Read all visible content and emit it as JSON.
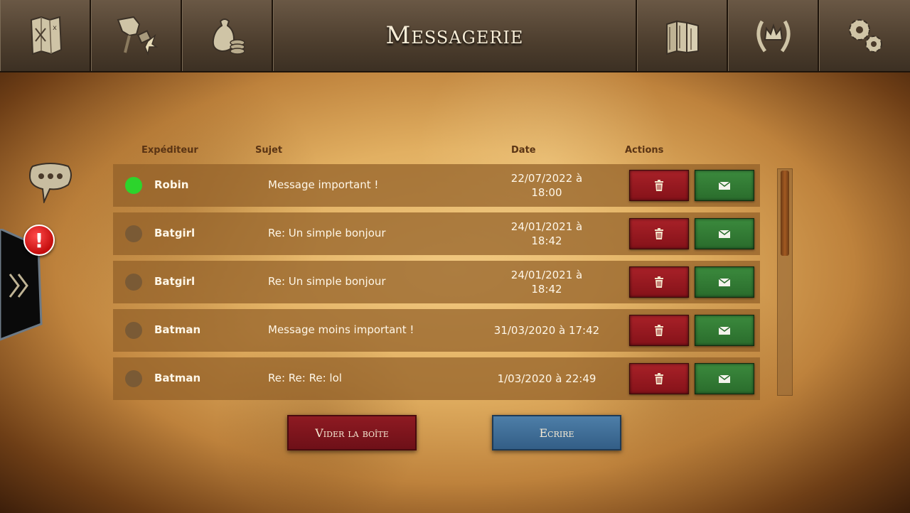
{
  "header": {
    "title": "Messagerie",
    "icons_left": [
      "map-icon",
      "hammer-icon",
      "treasure-bag-icon"
    ],
    "icons_right": [
      "books-icon",
      "crown-laurel-icon",
      "gears-icon"
    ]
  },
  "side": {
    "chat_icon": "speech-bubble-icon",
    "alert_symbol": "!",
    "expand_icon": "double-chevron-right-icon"
  },
  "table": {
    "columns": [
      "Expéditeur",
      "Sujet",
      "Date",
      "Actions"
    ],
    "rows": [
      {
        "sender": "Robin",
        "subject": "Message important !",
        "date": "22/07/2022 à 18:00",
        "unread": true
      },
      {
        "sender": "Batgirl",
        "subject": "Re: Un simple bonjour",
        "date": "24/01/2021 à 18:42",
        "unread": false
      },
      {
        "sender": "Batgirl",
        "subject": "Re: Un simple bonjour",
        "date": "24/01/2021 à 18:42",
        "unread": false
      },
      {
        "sender": "Batman",
        "subject": "Message moins important !",
        "date": "31/03/2020 à 17:42",
        "unread": false
      },
      {
        "sender": "Batman",
        "subject": "Re: Re: Re: lol",
        "date": "1/03/2020 à 22:49",
        "unread": false
      }
    ]
  },
  "buttons": {
    "empty_label": "Vider la boîte",
    "write_label": "Ecrire"
  },
  "colors": {
    "delete": "#a82128",
    "reply": "#3b8a3d",
    "unread_dot": "#2cd42c",
    "write": "#4d7ea8"
  }
}
